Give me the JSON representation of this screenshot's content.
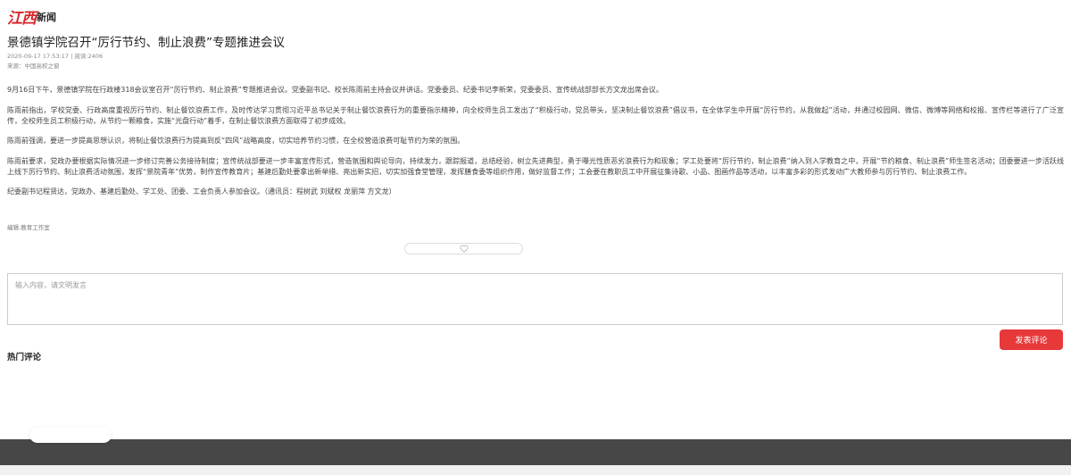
{
  "site": {
    "logo_red": "江西",
    "logo_dark": "新闻"
  },
  "article": {
    "title": "景德镇学院召开“厉行节约、制止浪费”专题推进会议",
    "date_views": "2020-09-17 17:53:17 | 阅读:2406",
    "source": "来源：中国高校之窗",
    "paragraphs": [
      "9月16日下午，景德镇学院在行政楼318会议室召开“厉行节约、制止浪费”专题推进会议。党委副书记、校长陈雨前主持会议并讲话。党委委员、纪委书记李新荣，党委委员、宣传统战部部长方文龙出席会议。",
      "陈雨前指出，学校党委、行政高度重视厉行节约、制止餐饮浪费工作，及时传达学习贯彻习近平总书记关于制止餐饮浪费行为的重要指示精神，向全校师生员工发出了“积极行动，党员带头，坚决制止餐饮浪费”倡议书，在全体学生中开展“厉行节约，从我做起”活动，并通过校园网、微信、微博等网络和校报、宣传栏等进行了广泛宣传，全校师生员工积极行动，从节约一颗粮食，实施“光盘行动”着手，在制止餐饮浪费方面取得了初步成效。",
      "陈雨前强调，要进一步提高思想认识，将制止餐饮浪费行为提高到反“四风”战略高度，切实培养节约习惯，在全校营造浪费可耻节约为荣的氛围。",
      "陈雨前要求，党政办要根据实际情况进一步修订完善公务接待制度；宣传统战部要进一步丰富宣传形式，营造氛围和舆论导向，持续发力，跟踪报道，总结经验，树立先进典型，勇于曝光性质恶劣浪费行为和现象；学工处要将“厉行节约，制止浪费”纳入到入学教育之中，开展“节约粮食、制止浪费”师生签名活动；团委要进一步活跃线上线下厉行节约、制止浪费活动氛围，发挥“景院青年”优势，制作宣传教育片；基建后勤处要拿出新举措、亮出新实招，切实加强食堂管理，发挥膳食委等组织作用，做好监督工作；工会要在教职员工中开展征集诗歌、小品、图画作品等活动，以丰富多彩的形式发动广大教师参与厉行节约、制止浪费工作。",
      "纪委副书记程贤达，党政办、基建后勤处、学工处、团委、工会负责人参加会议。（通讯员：程树武 刘斌权 龙丽萍 方文龙）"
    ],
    "editor": "编辑:教育工作室"
  },
  "comments": {
    "placeholder": "输入内容，请文明发言",
    "submit_label": "发表评论",
    "hot_label": "热门评论"
  },
  "colors": {
    "brand_red": "#d8262a",
    "button_red": "#e8393a",
    "footer": "#474747"
  },
  "icons": {
    "like": "heart-outline-icon"
  }
}
